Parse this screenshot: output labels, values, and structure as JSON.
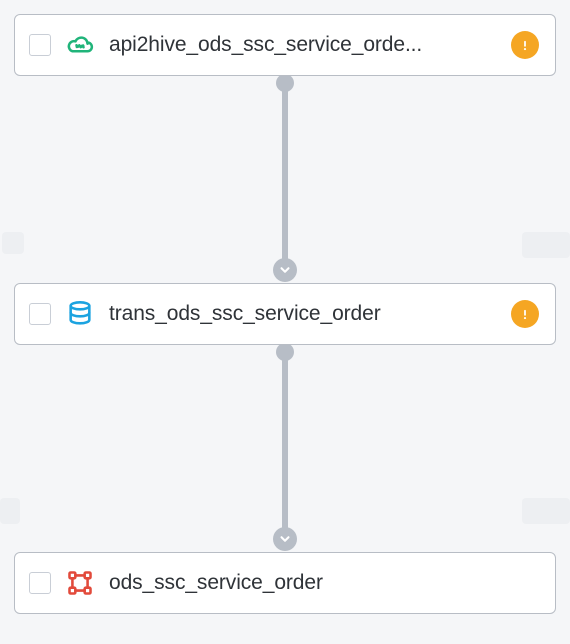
{
  "nodes": [
    {
      "id": "api2hive",
      "label": "api2hive_ods_ssc_service_orde...",
      "icon": "cloud-sync-icon",
      "icon_color": "#20b47a",
      "status": "warning"
    },
    {
      "id": "trans",
      "label": "trans_ods_ssc_service_order",
      "icon": "database-icon",
      "icon_color": "#1ba3e0",
      "status": "warning"
    },
    {
      "id": "ods",
      "label": "ods_ssc_service_order",
      "icon": "topology-icon",
      "icon_color": "#e24a3b",
      "status": "none"
    }
  ],
  "edges": [
    {
      "from": "api2hive",
      "to": "trans"
    },
    {
      "from": "trans",
      "to": "ods"
    }
  ],
  "status_colors": {
    "warning": "#f5a623"
  }
}
